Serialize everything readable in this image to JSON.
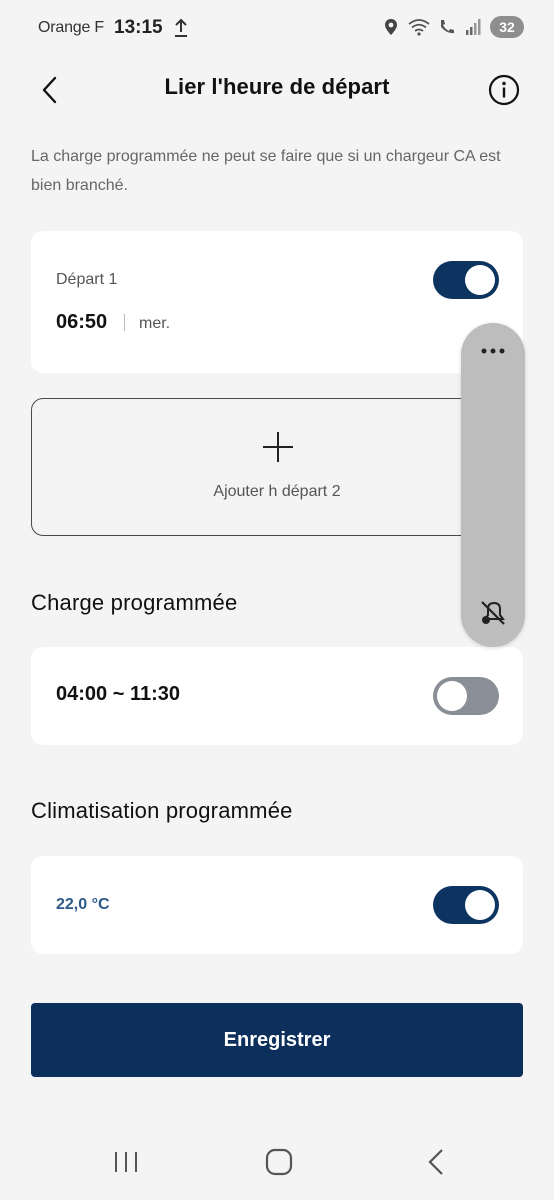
{
  "status_bar": {
    "carrier": "Orange F",
    "time": "13:15",
    "battery": "32",
    "icons": [
      "upload-icon",
      "location-icon",
      "wifi-6e-icon",
      "wifi-call-icon",
      "signal-icon",
      "battery-icon"
    ]
  },
  "header": {
    "title": "Lier l'heure de départ",
    "back_icon": "chevron-left-icon",
    "info_icon": "info-icon"
  },
  "note": "La charge programmée ne peut se faire que si un chargeur CA est bien branché.",
  "departure_1": {
    "label": "Départ 1",
    "time": "06:50",
    "day": "mer.",
    "enabled": true
  },
  "add_departure": {
    "label": "Ajouter h départ 2",
    "icon": "plus-icon"
  },
  "scheduled_charge": {
    "title": "Charge programmée",
    "range": "04:00 ~ 11:30",
    "enabled": false
  },
  "scheduled_climate": {
    "title": "Climatisation programmée",
    "temperature": "22,0 °C",
    "enabled": true
  },
  "save_button": "Enregistrer",
  "floating_pill": {
    "icons": [
      "more-horizontal-icon",
      "mute-notifications-icon"
    ]
  },
  "nav_bar": {
    "icons": [
      "recents-icon",
      "home-icon",
      "back-icon"
    ]
  },
  "colors": {
    "accent": "#0d3461",
    "button": "#0d2f5c",
    "toggle_off": "#8a8e96",
    "background": "#f4f4f5",
    "temperature_text": "#2b5a8a"
  }
}
